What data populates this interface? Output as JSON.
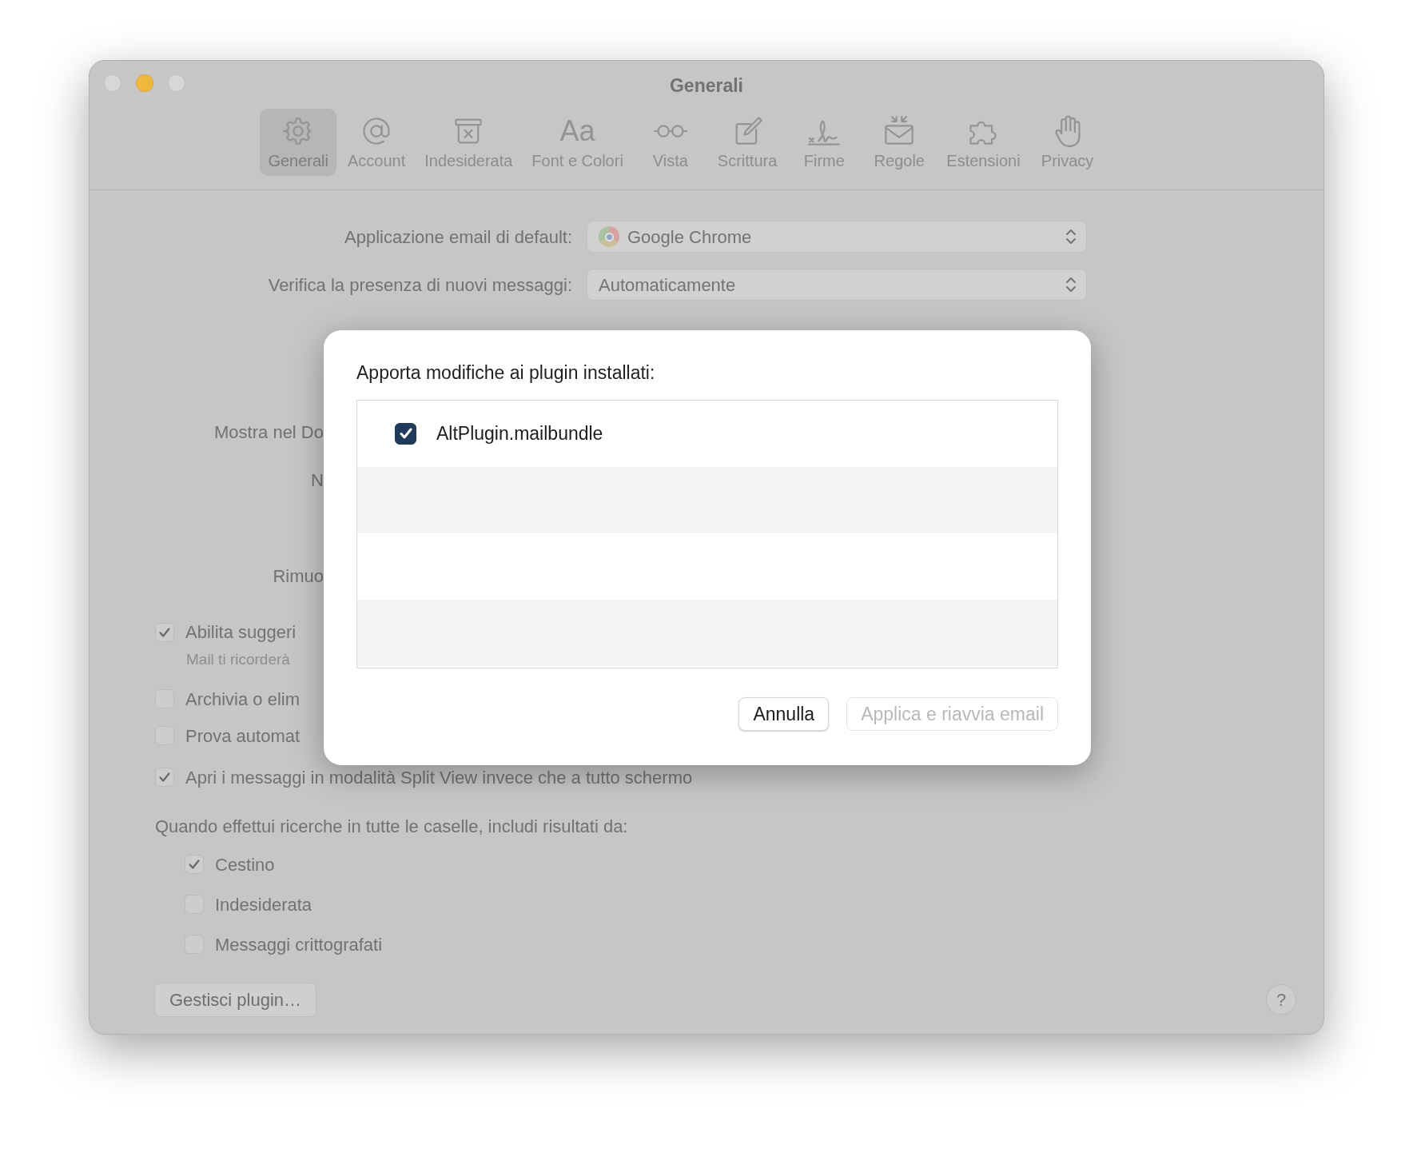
{
  "window": {
    "title": "Generali",
    "controls": [
      {
        "enabled": false
      },
      {
        "enabled": true
      },
      {
        "enabled": false
      }
    ]
  },
  "toolbar": [
    {
      "label": "Generali",
      "selected": true
    },
    {
      "label": "Account",
      "selected": false
    },
    {
      "label": "Indesiderata",
      "selected": false
    },
    {
      "label": "Font e Colori",
      "selected": false,
      "glyph": "Aa"
    },
    {
      "label": "Vista",
      "selected": false
    },
    {
      "label": "Scrittura",
      "selected": false
    },
    {
      "label": "Firme",
      "selected": false
    },
    {
      "label": "Regole",
      "selected": false
    },
    {
      "label": "Estensioni",
      "selected": false
    },
    {
      "label": "Privacy",
      "selected": false
    }
  ],
  "settings": [
    {
      "kind": "popup",
      "label": "Applicazione email di default:",
      "value": "Google Chrome",
      "app_icon": true
    },
    {
      "kind": "popup",
      "label": "Verifica la presenza di nuovi messaggi:",
      "value": "Automaticamente"
    },
    {
      "kind": "partial",
      "label": "Mostra nel Do"
    },
    {
      "kind": "partial",
      "label": "N"
    },
    {
      "kind": "partial",
      "label": "Rimuo"
    },
    {
      "kind": "checkbox",
      "label": "Abilita suggeri",
      "checked": true,
      "note": "Mail ti ricorderà"
    },
    {
      "kind": "checkbox",
      "label": "Archivia o elim",
      "checked": false
    },
    {
      "kind": "checkbox",
      "label": "Prova automat",
      "checked": false
    },
    {
      "kind": "checkbox",
      "label": "Apri i messaggi in modalità Split View invece che a tutto schermo",
      "checked": true
    }
  ],
  "search_section": {
    "heading": "Quando effettui ricerche in tutte le caselle, includi risultati da:",
    "options": [
      {
        "label": "Cestino",
        "checked": true
      },
      {
        "label": "Indesiderata",
        "checked": false
      },
      {
        "label": "Messaggi crittografati",
        "checked": false
      }
    ]
  },
  "manage_button": "Gestisci plugin…",
  "help_button": "?",
  "dialog": {
    "title": "Apporta modifiche ai plugin installati:",
    "plugins": [
      {
        "name": "AltPlugin.mailbundle",
        "checked": true
      }
    ],
    "buttons": [
      {
        "label": "Annulla",
        "disabled": false
      },
      {
        "label": "Applica e riavvia email",
        "disabled": true
      }
    ]
  }
}
